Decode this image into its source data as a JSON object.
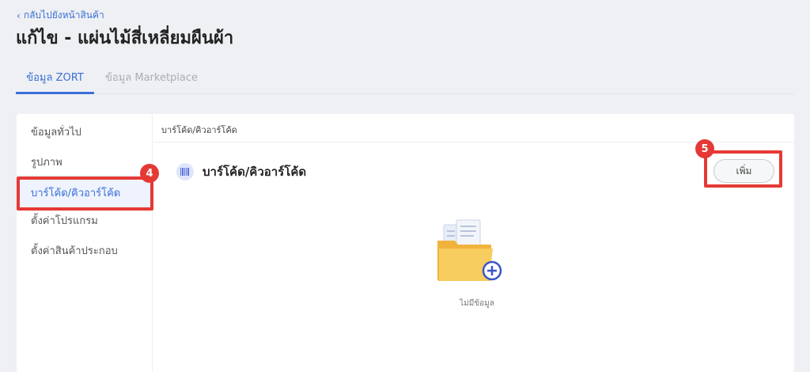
{
  "header": {
    "back_label": "กลับไปยังหน้าสินค้า",
    "title": "แก้ไข - แผ่นไม้สี่เหลี่ยมผืนผ้า"
  },
  "tabs": [
    {
      "label": "ข้อมูล ZORT",
      "active": true
    },
    {
      "label": "ข้อมูล Marketplace",
      "active": false
    }
  ],
  "sidebar": {
    "items": [
      {
        "label": "ข้อมูลทั่วไป",
        "active": false
      },
      {
        "label": "รูปภาพ",
        "active": false
      },
      {
        "label": "บาร์โค้ด/คิวอาร์โค้ด",
        "active": true
      },
      {
        "label": "ตั้งค่าโปรแกรม",
        "active": false
      },
      {
        "label": "ตั้งค่าสินค้าประกอบ",
        "active": false
      }
    ]
  },
  "main": {
    "breadcrumb": "บาร์โค้ด/คิวอาร์โค้ด",
    "section_title": "บาร์โค้ด/คิวอาร์โค้ด",
    "section_icon": "barcode-icon",
    "add_button": "เพิ่ม",
    "empty_icon": "empty-folder-icon",
    "empty_text": "ไม่มีข้อมูล"
  },
  "annotations": {
    "badge_4": "4",
    "badge_5": "5"
  },
  "colors": {
    "accent": "#3b6fd8",
    "annotation": "#e53935",
    "folder": "#f6c453"
  }
}
